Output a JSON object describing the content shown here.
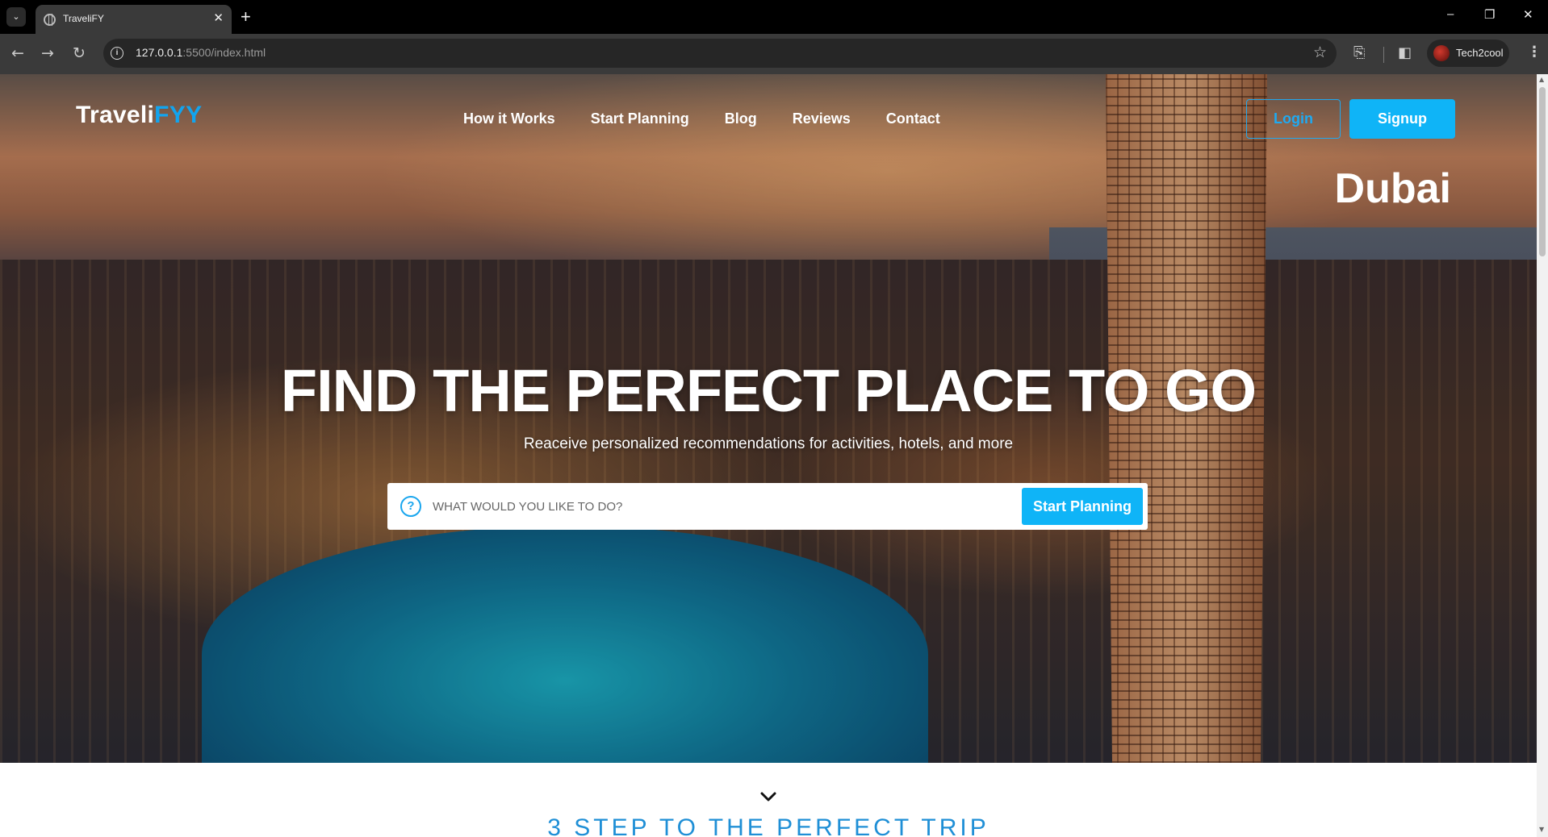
{
  "browser": {
    "tab_title": "TraveliFY",
    "tab_close": "✕",
    "new_tab": "+",
    "url_host": "127.0.0.1",
    "url_path": ":5500/index.html",
    "profile_name": "Tech2cool",
    "window_controls": [
      "–",
      "❐",
      "✕"
    ]
  },
  "header": {
    "logo_main": "Traveli",
    "logo_accent": "FYY",
    "nav": [
      "How it Works",
      "Start Planning",
      "Blog",
      "Reviews",
      "Contact"
    ],
    "login_label": "Login",
    "signup_label": "Signup"
  },
  "hero": {
    "city": "Dubai",
    "headline": "FIND THE PERFECT PLACE TO GO",
    "subline": "Reaceive personalized recommendations for activities, hotels, and more",
    "search_placeholder": "WHAT WOULD YOU LIKE TO DO?",
    "search_icon": "?",
    "search_button": "Start Planning"
  },
  "next_section": {
    "title": "3 STEP TO THE PERFECT TRIP"
  },
  "colors": {
    "accent": "#0fb4f7",
    "title_blue": "#1f8fd6"
  },
  "icons": [
    "chevron-down-icon",
    "globe-icon",
    "back-arrow-icon",
    "forward-arrow-icon",
    "reload-icon",
    "info-icon",
    "star-icon",
    "extensions-icon",
    "side-panel-icon",
    "menu-kebab-icon",
    "question-icon"
  ]
}
